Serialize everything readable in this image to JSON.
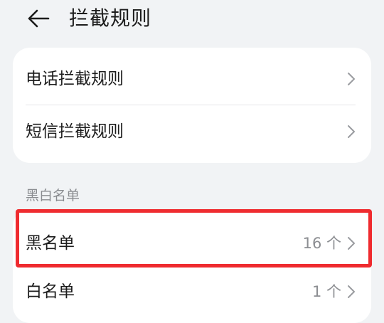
{
  "header": {
    "back_icon": "arrow-left-icon",
    "title": "拦截规则"
  },
  "rules_card": {
    "items": [
      {
        "label": "电话拦截规则",
        "icon": "chevron-right-icon"
      },
      {
        "label": "短信拦截规则",
        "icon": "chevron-right-icon"
      }
    ]
  },
  "list_section": {
    "title": "黑白名单",
    "items": [
      {
        "label": "黑名单",
        "value": "16 个",
        "icon": "chevron-right-icon",
        "highlighted": true
      },
      {
        "label": "白名单",
        "value": "1 个",
        "icon": "chevron-right-icon",
        "highlighted": false
      }
    ]
  },
  "colors": {
    "background": "#f1f3f5",
    "card": "#ffffff",
    "highlight_border": "#ef2b2f",
    "secondary_text": "#8a8c90"
  }
}
